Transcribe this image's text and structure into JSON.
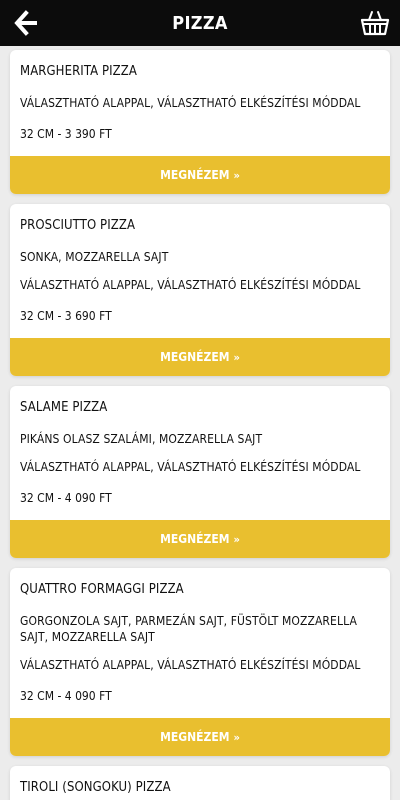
{
  "header": {
    "title": "PIZZA",
    "back_icon": "arrow-left-icon",
    "cart_icon": "basket-icon"
  },
  "cta_label": "MEGNÉZEM",
  "cta_chevron": "»",
  "colors": {
    "topbar": "#0c0c0c",
    "accent": "#e9bf2f",
    "background": "#ececec"
  },
  "products": [
    {
      "name": "MARGHERITA PIZZA",
      "ingredients": "",
      "options": "VÁLASZTHATÓ ALAPPAL, VÁLASZTHATÓ ELKÉSZÍTÉSI MÓDDAL",
      "price": "32 CM - 3 390 FT"
    },
    {
      "name": "PROSCIUTTO PIZZA",
      "ingredients": "SONKA, MOZZARELLA SAJT",
      "options": "VÁLASZTHATÓ ALAPPAL, VÁLASZTHATÓ ELKÉSZÍTÉSI MÓDDAL",
      "price": "32 CM - 3 690 FT"
    },
    {
      "name": "SALAME PIZZA",
      "ingredients": "PIKÁNS OLASZ SZALÁMI, MOZZARELLA SAJT",
      "options": "VÁLASZTHATÓ ALAPPAL, VÁLASZTHATÓ ELKÉSZÍTÉSI MÓDDAL",
      "price": "32 CM - 4 090 FT"
    },
    {
      "name": "QUATTRO FORMAGGI PIZZA",
      "ingredients": "GORGONZOLA SAJT, PARMEZÁN SAJT, FÜSTÖLT MOZZARELLA SAJT, MOZZARELLA SAJT",
      "options": "VÁLASZTHATÓ ALAPPAL, VÁLASZTHATÓ ELKÉSZÍTÉSI MÓDDAL",
      "price": "32 CM - 4 090 FT"
    },
    {
      "name": "TIROLI (SONGOKU) PIZZA",
      "ingredients": "",
      "options": "",
      "price": ""
    }
  ]
}
